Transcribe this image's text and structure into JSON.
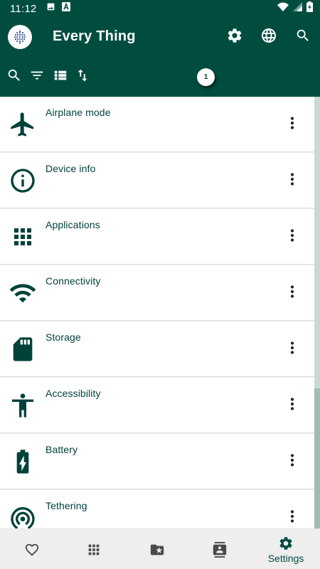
{
  "status_bar": {
    "time": "11:12",
    "icons": [
      "image-notification-icon",
      "a-notification-icon",
      "wifi-icon",
      "cell-signal-icon",
      "battery-icon"
    ]
  },
  "app_bar": {
    "title": "Every Thing",
    "logo": "app-logo-icon",
    "actions": [
      "settings-icon",
      "globe-icon",
      "search-icon"
    ]
  },
  "toolbar": {
    "tools": [
      "search-icon",
      "filter-icon",
      "list-view-icon",
      "sort-icon"
    ],
    "count_badge": "1"
  },
  "list": {
    "items": [
      {
        "label": "Airplane mode",
        "icon": "airplane-icon"
      },
      {
        "label": "Device info",
        "icon": "info-icon"
      },
      {
        "label": "Applications",
        "icon": "apps-grid-icon"
      },
      {
        "label": "Connectivity",
        "icon": "wifi-icon"
      },
      {
        "label": "Storage",
        "icon": "sd-card-icon"
      },
      {
        "label": "Accessibility",
        "icon": "accessibility-icon"
      },
      {
        "label": "Battery",
        "icon": "battery-charging-icon"
      },
      {
        "label": "Tethering",
        "icon": "hotspot-icon"
      }
    ]
  },
  "bottom_nav": {
    "items": [
      {
        "icon": "heart-icon",
        "label": ""
      },
      {
        "icon": "apps-grid-icon",
        "label": ""
      },
      {
        "icon": "folder-star-icon",
        "label": ""
      },
      {
        "icon": "contacts-icon",
        "label": ""
      },
      {
        "icon": "settings-icon",
        "label": "Settings"
      }
    ],
    "active_index": 4
  },
  "colors": {
    "primary": "#004d40",
    "icon": "#00423a",
    "background": "#ffffff",
    "divider": "#dcdcdc",
    "nav_background": "#eeeeee"
  }
}
